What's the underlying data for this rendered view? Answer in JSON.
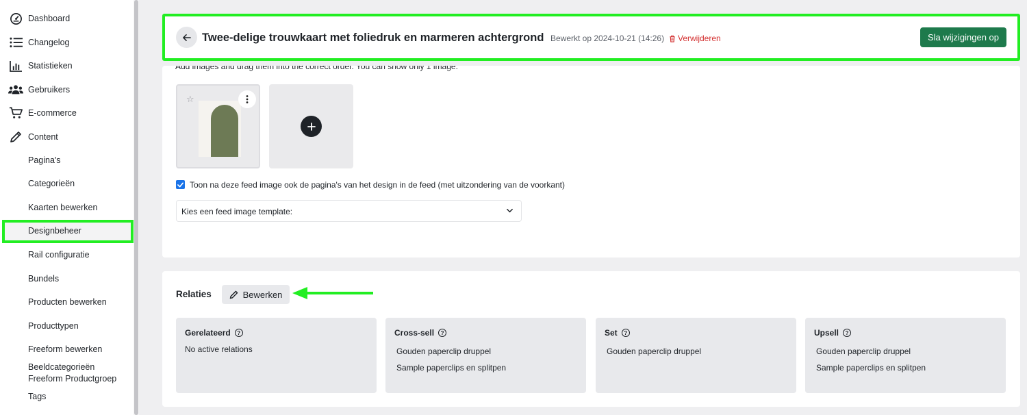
{
  "sidebar": {
    "items": [
      {
        "label": "Dashboard",
        "icon": "dashboard-gauge-icon"
      },
      {
        "label": "Changelog",
        "icon": "list-icon"
      },
      {
        "label": "Statistieken",
        "icon": "bar-chart-icon"
      },
      {
        "label": "Gebruikers",
        "icon": "users-icon"
      },
      {
        "label": "E-commerce",
        "icon": "cart-icon"
      },
      {
        "label": "Content",
        "icon": "pencil-icon"
      }
    ],
    "sub_items": [
      "Pagina's",
      "Categorieën",
      "Kaarten bewerken",
      "Designbeheer",
      "Rail configuratie",
      "Bundels",
      "Producten bewerken",
      "Producttypen",
      "Freeform bewerken",
      "Beeldcategorieën Freeform Productgroep",
      "Tags"
    ],
    "active_item": "Designbeheer"
  },
  "header": {
    "title": "Twee-delige trouwkaart met foliedruk en marmeren achtergrond",
    "edited": "Bewerkt op 2024-10-21 (14:26)",
    "delete_label": "Verwijderen",
    "save_label": "Sla wijzigingen op"
  },
  "images": {
    "hint": "Add images and drag them into the correct order. You can show only 1 image.",
    "checkbox_checked": true,
    "checkbox_label": "Toon na deze feed image ook de pagina's van het design in de feed (met uitzondering van de voorkant)",
    "select_value": "Kies een feed image template:"
  },
  "relations": {
    "title": "Relaties",
    "edit_label": "Bewerken",
    "groups": [
      {
        "title": "Gerelateerd",
        "empty": "No active relations",
        "items": []
      },
      {
        "title": "Cross-sell",
        "items": [
          "Gouden paperclip druppel",
          "Sample paperclips en splitpen"
        ]
      },
      {
        "title": "Set",
        "items": [
          "Gouden paperclip druppel"
        ]
      },
      {
        "title": "Upsell",
        "items": [
          "Gouden paperclip druppel",
          "Sample paperclips en splitpen"
        ]
      }
    ]
  },
  "colors": {
    "accent_green": "#1e7a4c",
    "highlight": "#22ee22",
    "danger": "#d32f2f",
    "checkbox": "#1a73e8"
  }
}
